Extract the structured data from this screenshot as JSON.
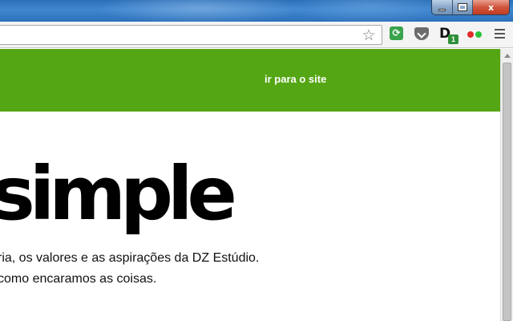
{
  "window": {
    "minimize_label": "",
    "maximize_label": "",
    "close_label": "x"
  },
  "toolbar": {
    "bookmark_icon": "star-icon",
    "extensions": [
      {
        "name": "sync-icon",
        "color": "#3aa34d"
      },
      {
        "name": "pocket-icon",
        "color": "#6c6c6c"
      },
      {
        "name": "d-extension-icon",
        "letter": "D",
        "badge": "1",
        "color": "#2f8f3a"
      },
      {
        "name": "dots-extension-icon",
        "colors": [
          "#e22b2b",
          "#29c13b"
        ]
      }
    ],
    "menu_icon": "hamburger-menu-icon"
  },
  "page": {
    "banner_color": "#55a614",
    "site_link": "ir para o site",
    "hero_title": "simple",
    "paragraph_line1": "ria, os valores e as aspirações da DZ Estúdio.",
    "paragraph_line2": "como encaramos as coisas."
  }
}
